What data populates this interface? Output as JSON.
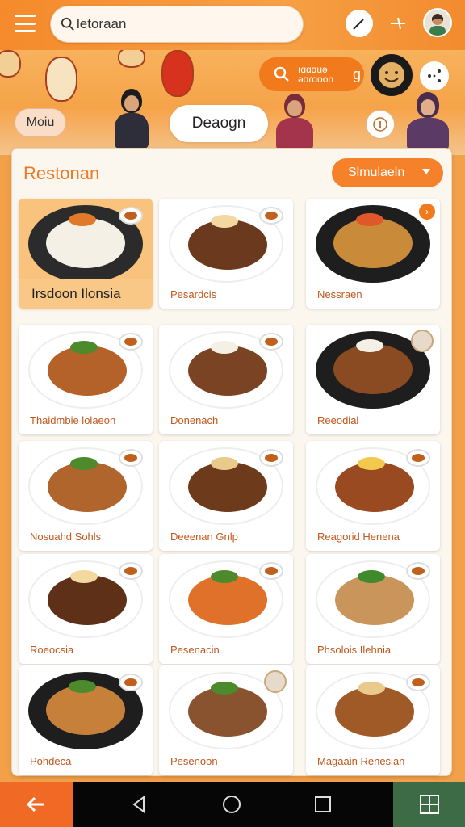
{
  "search": {
    "value": "letoraan"
  },
  "hero": {
    "menu_pill": "Moiu",
    "center_pill": "Deaogn",
    "orange_pill": {
      "line1": "ıɑɑɑuǝ",
      "line2": "ǝɑɾɑoon",
      "suffix": "g"
    }
  },
  "panel": {
    "title": "Restonan",
    "sim_button": "Slmulaeln"
  },
  "cards": [
    {
      "label": "Irsdoon Ilonsia",
      "featured": true,
      "plate": "#2b2b2b",
      "food": "#f4f0e6",
      "garnish": "#e07a2a"
    },
    {
      "label": "Pesardcis",
      "plate": "#ffffff",
      "food": "#6b3a1e",
      "garnish": "#f3d9a0"
    },
    {
      "label": "Nessraen",
      "plate": "#1e1e1e",
      "food": "#c98a3a",
      "garnish": "#e0582a",
      "badge": true
    },
    {
      "label": "Thaidmbie lolaeon",
      "plate": "#ffffff",
      "food": "#b5622a",
      "garnish": "#4c8a2c"
    },
    {
      "label": "Donenach",
      "plate": "#ffffff",
      "food": "#7a4424",
      "garnish": "#f4f0e6"
    },
    {
      "label": "Reeodial",
      "plate": "#1e1e1e",
      "food": "#8a4a22",
      "garnish": "#f4f0e6",
      "avatar": true
    },
    {
      "label": "Nosuahd Sohls",
      "plate": "#ffffff",
      "food": "#b0652c",
      "garnish": "#4c8a2c"
    },
    {
      "label": "Deeenan Gnlp",
      "plate": "#ffffff",
      "food": "#6e3a1c",
      "garnish": "#e9c98c"
    },
    {
      "label": "Reagorid Henena",
      "plate": "#ffffff",
      "food": "#9a4a20",
      "garnish": "#f2c94c"
    },
    {
      "label": "Roeocsia",
      "plate": "#ffffff",
      "food": "#5e3018",
      "garnish": "#f3d9a0"
    },
    {
      "label": "Pesenacin",
      "plate": "#ffffff",
      "food": "#e0712a",
      "garnish": "#4c8a2c"
    },
    {
      "label": "Phsolois Ilehnia",
      "plate": "#ffffff",
      "food": "#c9955a",
      "garnish": "#3f8a2c"
    },
    {
      "label": "Pohdeca",
      "plate": "#1e1e1e",
      "food": "#c7803a",
      "garnish": "#4c8a2c"
    },
    {
      "label": "Pesenoon",
      "plate": "#ffffff",
      "food": "#8a5330",
      "garnish": "#4c8a2c",
      "avatar": true
    },
    {
      "label": "Magaain Renesian",
      "plate": "#ffffff",
      "food": "#a05a28",
      "garnish": "#e9c98c"
    }
  ],
  "colors": {
    "accent": "#f5822a",
    "label_text": "#c2581c",
    "nav_back": "#f06a26",
    "nav_menu": "#3d6b46"
  },
  "icons": {
    "menu": "hamburger-icon",
    "search": "search-icon",
    "top_action_1": "pencil-icon",
    "top_action_2": "sparkle-icon",
    "back": "arrow-left-icon",
    "home": "circle-home-icon",
    "recents": "square-recents-icon",
    "nav_back": "triangle-back-icon",
    "grid": "grid-icon"
  }
}
